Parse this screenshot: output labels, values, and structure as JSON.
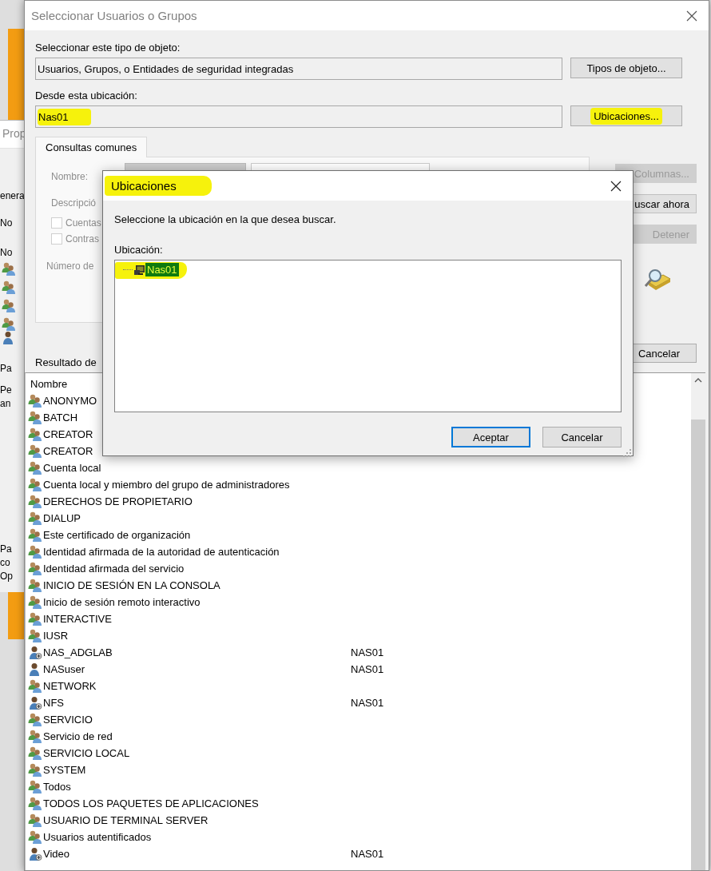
{
  "background_window": {
    "title": "Prop",
    "items": [
      {
        "kind": "tab",
        "text": "enera"
      },
      {
        "kind": "text",
        "text": "No"
      },
      {
        "kind": "text",
        "text": "No"
      },
      {
        "kind": "group"
      },
      {
        "kind": "group"
      },
      {
        "kind": "group"
      },
      {
        "kind": "group"
      },
      {
        "kind": "user"
      },
      {
        "kind": "text",
        "text": "Pa"
      },
      {
        "kind": "text",
        "text": "Pe"
      },
      {
        "kind": "text",
        "text": "an"
      },
      {
        "kind": "text",
        "text": "Pa"
      },
      {
        "kind": "text",
        "text": "co"
      },
      {
        "kind": "text",
        "text": "Op"
      }
    ]
  },
  "dialog": {
    "title": "Seleccionar Usuarios o Grupos",
    "object_type": {
      "label": "Seleccionar este tipo de objeto:",
      "value": "Usuarios, Grupos, o Entidades de seguridad integradas",
      "button": "Tipos de objeto..."
    },
    "location": {
      "label": "Desde esta ubicación:",
      "value": "Nas01",
      "highlighted": true,
      "button": "Ubicaciones...",
      "button_highlighted": true
    },
    "tabs": [
      {
        "label": "Consultas comunes",
        "selected": true
      }
    ],
    "query": {
      "fields": [
        {
          "label": "Nombre:"
        },
        {
          "label": "Descripció"
        }
      ],
      "checkboxes": [
        {
          "label": "Cuentas",
          "checked": false
        },
        {
          "label": "Contras",
          "checked": false
        }
      ],
      "days_label": "Número de"
    },
    "side_buttons": [
      {
        "label": "Columnas...",
        "disabled": true
      },
      {
        "label": "uscar ahora",
        "disabled": false
      },
      {
        "label": "Detener",
        "disabled": true
      }
    ],
    "cancel_button": "Cancelar",
    "results_label": "Resultado de",
    "results": {
      "columns": [
        "Nombre"
      ],
      "rows": [
        {
          "name": "ANONYMO",
          "kind": "group"
        },
        {
          "name": "BATCH",
          "kind": "group"
        },
        {
          "name": "CREATOR",
          "kind": "group"
        },
        {
          "name": "CREATOR",
          "kind": "group"
        },
        {
          "name": "Cuenta local",
          "kind": "group"
        },
        {
          "name": "Cuenta local y miembro del grupo de administradores",
          "kind": "group"
        },
        {
          "name": "DERECHOS DE PROPIETARIO",
          "kind": "group"
        },
        {
          "name": "DIALUP",
          "kind": "group"
        },
        {
          "name": "Este certificado de organización",
          "kind": "group"
        },
        {
          "name": "Identidad afirmada de la autoridad de autenticación",
          "kind": "group"
        },
        {
          "name": "Identidad afirmada del servicio",
          "kind": "group"
        },
        {
          "name": "INICIO DE SESIÓN EN LA CONSOLA",
          "kind": "group"
        },
        {
          "name": "Inicio de sesión remoto interactivo",
          "kind": "group"
        },
        {
          "name": "INTERACTIVE",
          "kind": "group"
        },
        {
          "name": "IUSR",
          "kind": "group"
        },
        {
          "name": "NAS_ADGLAB",
          "folder": "NAS01",
          "kind": "account"
        },
        {
          "name": "NASuser",
          "folder": "NAS01",
          "kind": "user"
        },
        {
          "name": "NETWORK",
          "kind": "group"
        },
        {
          "name": "NFS",
          "folder": "NAS01",
          "kind": "account"
        },
        {
          "name": "SERVICIO",
          "kind": "group"
        },
        {
          "name": "Servicio de red",
          "kind": "group"
        },
        {
          "name": "SERVICIO LOCAL",
          "kind": "group"
        },
        {
          "name": "SYSTEM",
          "kind": "group"
        },
        {
          "name": "Todos",
          "kind": "group"
        },
        {
          "name": "TODOS LOS PAQUETES DE APLICACIONES",
          "kind": "group"
        },
        {
          "name": "USUARIO DE TERMINAL SERVER",
          "kind": "group"
        },
        {
          "name": "Usuarios autentificados",
          "kind": "group"
        },
        {
          "name": "Video",
          "folder": "NAS01",
          "kind": "account"
        }
      ]
    }
  },
  "locations_dialog": {
    "title": "Ubicaciones",
    "title_highlighted": true,
    "prompt": "Seleccione la ubicación en la que desea buscar.",
    "tree_label": "Ubicación:",
    "tree": [
      {
        "label": "Nas01",
        "selected": true,
        "highlighted": true
      }
    ],
    "buttons": [
      {
        "label": "Aceptar",
        "default": true
      },
      {
        "label": "Cancelar",
        "default": false
      }
    ]
  }
}
